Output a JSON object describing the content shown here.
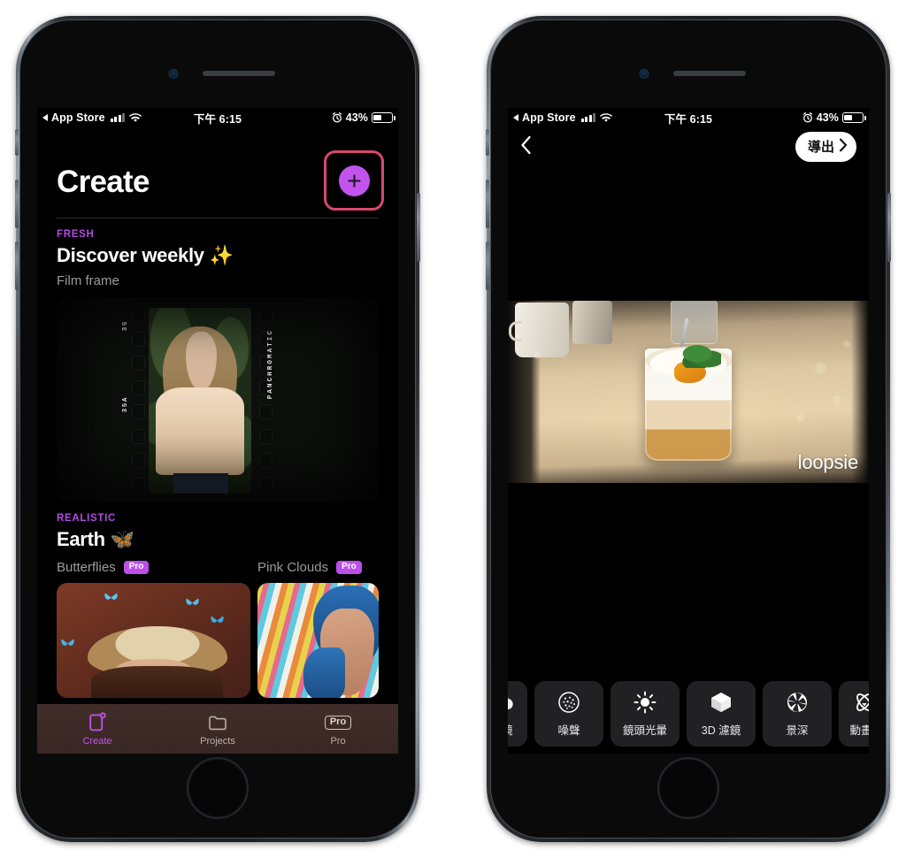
{
  "statusbar": {
    "back_app": "App Store",
    "time": "下午 6:15",
    "battery_percent": "43%",
    "signal_icon": "cellular-bars-icon",
    "wifi_icon": "wifi-icon",
    "alarm_icon": "alarm-clock-icon",
    "battery_icon": "battery-icon"
  },
  "left_phone": {
    "header": {
      "title": "Create",
      "add_icon": "plus-icon"
    },
    "sections": [
      {
        "kicker": "FRESH",
        "title": "Discover weekly ✨",
        "subtitle": "Film frame",
        "film": {
          "label_top": "35",
          "label_bottom": "35A",
          "label_right": "PANCHROMATIC"
        }
      },
      {
        "kicker": "REALISTIC",
        "title": "Earth 🦋",
        "items": [
          {
            "label": "Butterflies",
            "badge": "Pro"
          },
          {
            "label": "Pink Clouds",
            "badge": "Pro"
          }
        ]
      }
    ],
    "tabbar": [
      {
        "label": "Create",
        "icon": "create-document-plus-icon",
        "active": true
      },
      {
        "label": "Projects",
        "icon": "folder-icon",
        "active": false
      },
      {
        "label": "Pro",
        "icon": "pro-badge-icon",
        "active": false
      }
    ]
  },
  "right_phone": {
    "navbar": {
      "back_icon": "chevron-left-icon",
      "export_label": "導出",
      "export_chevron_icon": "chevron-right-icon"
    },
    "preview": {
      "watermark": "loopsie"
    },
    "toolbar": [
      {
        "label": "濾鏡",
        "icon": "bokeh-circles-icon"
      },
      {
        "label": "噪聲",
        "icon": "noise-grain-icon"
      },
      {
        "label": "鏡頭光暈",
        "icon": "sun-flare-icon"
      },
      {
        "label": "3D 濾鏡",
        "icon": "cube-3d-icon"
      },
      {
        "label": "景深",
        "icon": "aperture-icon"
      },
      {
        "label": "動畫",
        "icon": "orbit-animation-icon"
      }
    ]
  },
  "colors": {
    "accent_purple": "#c254ed",
    "kicker_purple": "#b24ce0",
    "highlight_pink": "#d8486f",
    "pro_badge": "#bb4fe8"
  }
}
